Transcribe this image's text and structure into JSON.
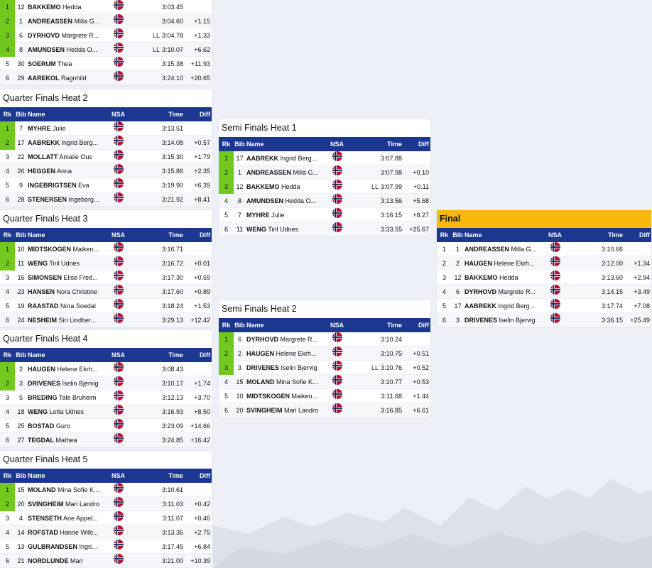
{
  "headers": {
    "rk": "Rk",
    "bib": "Bib",
    "name": "Name",
    "nsa": "NSA",
    "time": "Time",
    "diff": "Diff"
  },
  "colors": {
    "header": "#1b3790",
    "qualified": "#72c81d",
    "final": "#f8b90e"
  },
  "flag_icon": "norway-flag-icon",
  "heats": [
    {
      "id": "qf1",
      "title": "",
      "rows": [
        {
          "rk": "1",
          "bib": "12",
          "last": "BAKKEMO",
          "first": "Hedda",
          "ll": "",
          "time": "3:03.45",
          "diff": "",
          "q": true
        },
        {
          "rk": "2",
          "bib": "1",
          "last": "ANDREASSEN",
          "first": "Milla G...",
          "ll": "",
          "time": "3:04.60",
          "diff": "+1.15",
          "q": true
        },
        {
          "rk": "3",
          "bib": "6",
          "last": "DYRHOVD",
          "first": "Margrete R...",
          "ll": "LL",
          "time": "3:04.78",
          "diff": "+1.33",
          "q": true
        },
        {
          "rk": "4",
          "bib": "8",
          "last": "AMUNDSEN",
          "first": "Hedda O...",
          "ll": "LL",
          "time": "3:10.07",
          "diff": "+6.62",
          "q": true
        },
        {
          "rk": "5",
          "bib": "30",
          "last": "SOERUM",
          "first": "Thea",
          "ll": "",
          "time": "3:15.38",
          "diff": "+11.93",
          "q": false
        },
        {
          "rk": "6",
          "bib": "29",
          "last": "AAREKOL",
          "first": "Ragnhild",
          "ll": "",
          "time": "3:24.10",
          "diff": "+20.65",
          "q": false
        }
      ]
    },
    {
      "id": "qf2",
      "title": "Quarter Finals Heat 2",
      "rows": [
        {
          "rk": "1",
          "bib": "7",
          "last": "MYHRE",
          "first": "Julie",
          "ll": "",
          "time": "3:13.51",
          "diff": "",
          "q": true
        },
        {
          "rk": "2",
          "bib": "17",
          "last": "AABREKK",
          "first": "Ingrid Berg...",
          "ll": "",
          "time": "3:14.08",
          "diff": "+0.57",
          "q": true
        },
        {
          "rk": "3",
          "bib": "22",
          "last": "MOLLATT",
          "first": "Amalie Ous",
          "ll": "",
          "time": "3:15.30",
          "diff": "+1.79",
          "q": false
        },
        {
          "rk": "4",
          "bib": "26",
          "last": "HEGGEN",
          "first": "Anna",
          "ll": "",
          "time": "3:15.86",
          "diff": "+2.35",
          "q": false
        },
        {
          "rk": "5",
          "bib": "9",
          "last": "INGEBRIGTSEN",
          "first": "Eva",
          "ll": "",
          "time": "3:19.90",
          "diff": "+6.39",
          "q": false
        },
        {
          "rk": "6",
          "bib": "28",
          "last": "STENERSEN",
          "first": "Ingeborg...",
          "ll": "",
          "time": "3:21.92",
          "diff": "+8.41",
          "q": false
        }
      ]
    },
    {
      "id": "qf3",
      "title": "Quarter Finals Heat 3",
      "rows": [
        {
          "rk": "1",
          "bib": "10",
          "last": "MIDTSKOGEN",
          "first": "Maiken...",
          "ll": "",
          "time": "3:16.71",
          "diff": "",
          "q": true
        },
        {
          "rk": "2",
          "bib": "11",
          "last": "WENG",
          "first": "Tiril Udnes",
          "ll": "",
          "time": "3:16.72",
          "diff": "+0.01",
          "q": true
        },
        {
          "rk": "3",
          "bib": "16",
          "last": "SIMONSEN",
          "first": "Elise Fred...",
          "ll": "",
          "time": "3:17.30",
          "diff": "+0.59",
          "q": false
        },
        {
          "rk": "4",
          "bib": "23",
          "last": "HANSEN",
          "first": "Nora Christine",
          "ll": "",
          "time": "3:17.60",
          "diff": "+0.89",
          "q": false
        },
        {
          "rk": "5",
          "bib": "19",
          "last": "RAASTAD",
          "first": "Nora Soedal",
          "ll": "",
          "time": "3:18.24",
          "diff": "+1.53",
          "q": false
        },
        {
          "rk": "6",
          "bib": "24",
          "last": "NESHEIM",
          "first": "Siri Lindber...",
          "ll": "",
          "time": "3:29.13",
          "diff": "+12.42",
          "q": false
        }
      ]
    },
    {
      "id": "qf4",
      "title": "Quarter Finals Heat 4",
      "rows": [
        {
          "rk": "1",
          "bib": "2",
          "last": "HAUGEN",
          "first": "Helene Ekrh...",
          "ll": "",
          "time": "3:08.43",
          "diff": "",
          "q": true
        },
        {
          "rk": "2",
          "bib": "3",
          "last": "DRIVENES",
          "first": "Iselin Bjervig",
          "ll": "",
          "time": "3:10.17",
          "diff": "+1.74",
          "q": true
        },
        {
          "rk": "3",
          "bib": "5",
          "last": "BREDING",
          "first": "Tale Bruheim",
          "ll": "",
          "time": "3:12.13",
          "diff": "+3.70",
          "q": false
        },
        {
          "rk": "4",
          "bib": "18",
          "last": "WENG",
          "first": "Lotta Udnes",
          "ll": "",
          "time": "3:16.93",
          "diff": "+8.50",
          "q": false
        },
        {
          "rk": "5",
          "bib": "25",
          "last": "BOSTAD",
          "first": "Guro",
          "ll": "",
          "time": "3:23.09",
          "diff": "+14.66",
          "q": false
        },
        {
          "rk": "6",
          "bib": "27",
          "last": "TEGDAL",
          "first": "Mathea",
          "ll": "",
          "time": "3:24.85",
          "diff": "+16.42",
          "q": false
        }
      ]
    },
    {
      "id": "qf5",
      "title": "Quarter Finals Heat 5",
      "rows": [
        {
          "rk": "1",
          "bib": "15",
          "last": "MOLAND",
          "first": "Mina Sofie K...",
          "ll": "",
          "time": "3:10.61",
          "diff": "",
          "q": true
        },
        {
          "rk": "2",
          "bib": "20",
          "last": "SVINGHEIM",
          "first": "Mari Landro",
          "ll": "",
          "time": "3:11.03",
          "diff": "+0.42",
          "q": true
        },
        {
          "rk": "3",
          "bib": "4",
          "last": "STENSETH",
          "first": "Ane Appel...",
          "ll": "",
          "time": "3:11.07",
          "diff": "+0.46",
          "q": false
        },
        {
          "rk": "4",
          "bib": "14",
          "last": "ROFSTAD",
          "first": "Hanne Wilb...",
          "ll": "",
          "time": "3:13.36",
          "diff": "+2.75",
          "q": false
        },
        {
          "rk": "5",
          "bib": "13",
          "last": "GULBRANDSEN",
          "first": "Ingri...",
          "ll": "",
          "time": "3:17.45",
          "diff": "+6.84",
          "q": false
        },
        {
          "rk": "6",
          "bib": "21",
          "last": "NORDLUNDE",
          "first": "Mari",
          "ll": "",
          "time": "3:21.00",
          "diff": "+10.39",
          "q": false
        }
      ]
    },
    {
      "id": "sf1",
      "title": "Semi Finals Heat 1",
      "rows": [
        {
          "rk": "1",
          "bib": "17",
          "last": "AABREKK",
          "first": "Ingrid Berg...",
          "ll": "",
          "time": "3:07.88",
          "diff": "",
          "q": true
        },
        {
          "rk": "2",
          "bib": "1",
          "last": "ANDREASSEN",
          "first": "Milla G...",
          "ll": "",
          "time": "3:07.98",
          "diff": "+0.10",
          "q": true
        },
        {
          "rk": "3",
          "bib": "12",
          "last": "BAKKEMO",
          "first": "Hedda",
          "ll": "LL",
          "time": "3:07.99",
          "diff": "+0.11",
          "q": true
        },
        {
          "rk": "4",
          "bib": "8",
          "last": "AMUNDSEN",
          "first": "Hedda O...",
          "ll": "",
          "time": "3:13.56",
          "diff": "+5.68",
          "q": false
        },
        {
          "rk": "5",
          "bib": "7",
          "last": "MYHRE",
          "first": "Julie",
          "ll": "",
          "time": "3:16.15",
          "diff": "+8.27",
          "q": false
        },
        {
          "rk": "6",
          "bib": "11",
          "last": "WENG",
          "first": "Tiril Udnes",
          "ll": "",
          "time": "3:33.55",
          "diff": "+25.67",
          "q": false
        }
      ]
    },
    {
      "id": "sf2",
      "title": "Semi Finals Heat 2",
      "rows": [
        {
          "rk": "1",
          "bib": "6",
          "last": "DYRHOVD",
          "first": "Margrete R...",
          "ll": "",
          "time": "3:10.24",
          "diff": "",
          "q": true
        },
        {
          "rk": "2",
          "bib": "2",
          "last": "HAUGEN",
          "first": "Helene Ekrh...",
          "ll": "",
          "time": "3:10.75",
          "diff": "+0.51",
          "q": true
        },
        {
          "rk": "3",
          "bib": "3",
          "last": "DRIVENES",
          "first": "Iselin Bjervig",
          "ll": "LL",
          "time": "3:10.76",
          "diff": "+0.52",
          "q": true
        },
        {
          "rk": "4",
          "bib": "15",
          "last": "MOLAND",
          "first": "Mina Sofie K...",
          "ll": "",
          "time": "3:10.77",
          "diff": "+0.53",
          "q": false
        },
        {
          "rk": "5",
          "bib": "10",
          "last": "MIDTSKOGEN",
          "first": "Maiken...",
          "ll": "",
          "time": "3:11.68",
          "diff": "+1.44",
          "q": false
        },
        {
          "rk": "6",
          "bib": "20",
          "last": "SVINGHEIM",
          "first": "Mari Landro",
          "ll": "",
          "time": "3:16.85",
          "diff": "+6.61",
          "q": false
        }
      ]
    },
    {
      "id": "final",
      "title": "Final",
      "rows": [
        {
          "rk": "1",
          "bib": "1",
          "last": "ANDREASSEN",
          "first": "Milla G...",
          "ll": "",
          "time": "3:10.66",
          "diff": "",
          "q": false
        },
        {
          "rk": "2",
          "bib": "2",
          "last": "HAUGEN",
          "first": "Helene Ekrh...",
          "ll": "",
          "time": "3:12.00",
          "diff": "+1.34",
          "q": false
        },
        {
          "rk": "3",
          "bib": "12",
          "last": "BAKKEMO",
          "first": "Hedda",
          "ll": "",
          "time": "3:13.60",
          "diff": "+2.94",
          "q": false
        },
        {
          "rk": "4",
          "bib": "6",
          "last": "DYRHOVD",
          "first": "Margrete R...",
          "ll": "",
          "time": "3:14.15",
          "diff": "+3.49",
          "q": false
        },
        {
          "rk": "5",
          "bib": "17",
          "last": "AABREKK",
          "first": "Ingrid Berg...",
          "ll": "",
          "time": "3:17.74",
          "diff": "+7.08",
          "q": false
        },
        {
          "rk": "6",
          "bib": "3",
          "last": "DRIVENES",
          "first": "Iselin Bjervig",
          "ll": "",
          "time": "3:36.15",
          "diff": "+25.49",
          "q": false
        }
      ]
    }
  ]
}
